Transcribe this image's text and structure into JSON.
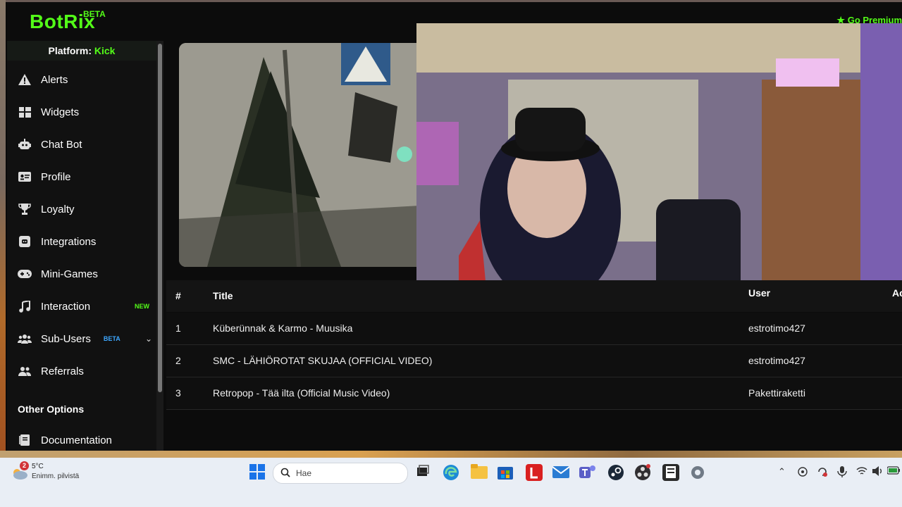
{
  "app": {
    "logo": "BotRix",
    "logo_badge": "BETA",
    "premium_label": "Go Premium"
  },
  "sidebar": {
    "platform_label": "Platform:",
    "platform_value": "Kick",
    "items": [
      {
        "label": "Alerts",
        "icon": "warning-icon"
      },
      {
        "label": "Widgets",
        "icon": "widgets-icon"
      },
      {
        "label": "Chat Bot",
        "icon": "robot-icon"
      },
      {
        "label": "Profile",
        "icon": "id-card-icon"
      },
      {
        "label": "Loyalty",
        "icon": "trophy-icon"
      },
      {
        "label": "Integrations",
        "icon": "discord-icon"
      },
      {
        "label": "Mini-Games",
        "icon": "gamepad-icon"
      },
      {
        "label": "Interaction",
        "icon": "music-icon",
        "badge": "NEW"
      },
      {
        "label": "Sub-Users",
        "icon": "users-icon",
        "badge": "BETA"
      },
      {
        "label": "Referrals",
        "icon": "user-friends-icon"
      }
    ],
    "other_title": "Other Options",
    "documentation": "Documentation"
  },
  "table": {
    "headers": {
      "num": "#",
      "title": "Title",
      "user": "User",
      "actions": "Ac"
    },
    "rows": [
      {
        "num": "1",
        "title": "Küberünnak & Karmo - Muusika",
        "user": "estrotimo427"
      },
      {
        "num": "2",
        "title": "SMC - LÄHIÖROTAT SKUJAA (OFFICIAL VIDEO)",
        "user": "estrotimo427"
      },
      {
        "num": "3",
        "title": "Retropop - Tää ilta (Official Music Video)",
        "user": "Pakettiraketti"
      }
    ]
  },
  "taskbar": {
    "weather_temp": "5°C",
    "weather_desc": "Enimm. pilvistä",
    "weather_badge": "2",
    "search_placeholder": "Hae"
  },
  "colors": {
    "accent": "#53fc18",
    "beta": "#3da7ff",
    "background": "#0c0c0c"
  }
}
